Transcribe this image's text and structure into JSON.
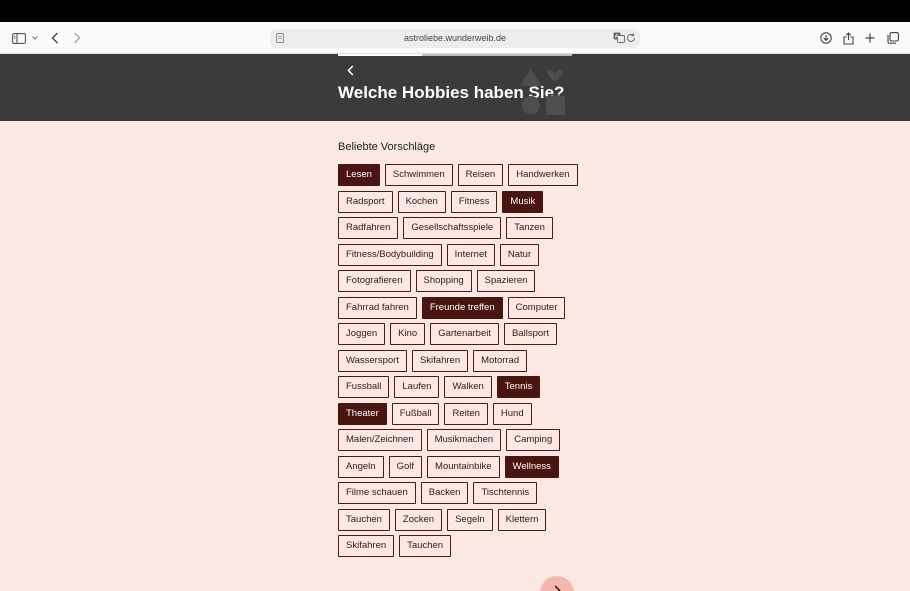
{
  "browser": {
    "url": "astroliebe.wunderweib.de"
  },
  "header": {
    "title": "Welche Hobbies haben Sie?",
    "progress": 0.36
  },
  "section": {
    "label": "Beliebte Vorschläge"
  },
  "chip_rows": [
    [
      {
        "label": "Lesen",
        "selected": true
      },
      {
        "label": "Schwimmen",
        "selected": false
      },
      {
        "label": "Reisen",
        "selected": false
      },
      {
        "label": "Handwerken",
        "selected": false
      }
    ],
    [
      {
        "label": "Radsport",
        "selected": false
      },
      {
        "label": "Kochen",
        "selected": false
      },
      {
        "label": "Fitness",
        "selected": false
      },
      {
        "label": "Musik",
        "selected": true
      }
    ],
    [
      {
        "label": "Radfahren",
        "selected": false
      },
      {
        "label": "Gesellschaftsspiele",
        "selected": false
      },
      {
        "label": "Tanzen",
        "selected": false
      }
    ],
    [
      {
        "label": "Fitness/Bodybuilding",
        "selected": false
      },
      {
        "label": "Internet",
        "selected": false
      },
      {
        "label": "Natur",
        "selected": false
      }
    ],
    [
      {
        "label": "Fotografieren",
        "selected": false
      },
      {
        "label": "Shopping",
        "selected": false
      },
      {
        "label": "Spazieren",
        "selected": false
      }
    ],
    [
      {
        "label": "Fahrrad fahren",
        "selected": false
      },
      {
        "label": "Freunde treffen",
        "selected": true
      },
      {
        "label": "Computer",
        "selected": false
      }
    ],
    [
      {
        "label": "Joggen",
        "selected": false
      },
      {
        "label": "Kino",
        "selected": false
      },
      {
        "label": "Gartenarbeit",
        "selected": false
      },
      {
        "label": "Ballsport",
        "selected": false
      }
    ],
    [
      {
        "label": "Wassersport",
        "selected": false
      },
      {
        "label": "Skifahren",
        "selected": false
      },
      {
        "label": "Motorrad",
        "selected": false
      }
    ],
    [
      {
        "label": "Fussball",
        "selected": false
      },
      {
        "label": "Laufen",
        "selected": false
      },
      {
        "label": "Walken",
        "selected": false
      },
      {
        "label": "Tennis",
        "selected": true
      }
    ],
    [
      {
        "label": "Theater",
        "selected": true
      },
      {
        "label": "Fußball",
        "selected": false
      },
      {
        "label": "Reiten",
        "selected": false
      },
      {
        "label": "Hund",
        "selected": false
      }
    ],
    [
      {
        "label": "Malen/Zeichnen",
        "selected": false
      },
      {
        "label": "Musikmachen",
        "selected": false
      },
      {
        "label": "Camping",
        "selected": false
      }
    ],
    [
      {
        "label": "Angeln",
        "selected": false
      },
      {
        "label": "Golf",
        "selected": false
      },
      {
        "label": "Mountainbike",
        "selected": false
      },
      {
        "label": "Wellness",
        "selected": true
      }
    ],
    [
      {
        "label": "Filme schauen",
        "selected": false
      },
      {
        "label": "Backen",
        "selected": false
      },
      {
        "label": "Tischtennis",
        "selected": false
      }
    ],
    [
      {
        "label": "Tauchen",
        "selected": false
      },
      {
        "label": "Zocken",
        "selected": false
      },
      {
        "label": "Segeln",
        "selected": false
      },
      {
        "label": "Klettern",
        "selected": false
      }
    ],
    [
      {
        "label": "Skifahren",
        "selected": false
      },
      {
        "label": "Tauchen",
        "selected": false
      }
    ]
  ],
  "icons": {
    "sidebar": "sidebar-icon",
    "back": "chevron-left-icon",
    "forward": "chevron-right-icon",
    "download": "download-icon",
    "share": "share-icon",
    "new_tab": "plus-icon",
    "tabs": "tabs-overview-icon",
    "translate": "translate-icon",
    "reload": "reload-icon",
    "next": "chevron-right-icon"
  },
  "colors": {
    "page_bg": "#fbe8e3",
    "header_bg": "#3b3b3b",
    "chip_selected": "#4a1410",
    "next_button": "#f2b7ad"
  }
}
